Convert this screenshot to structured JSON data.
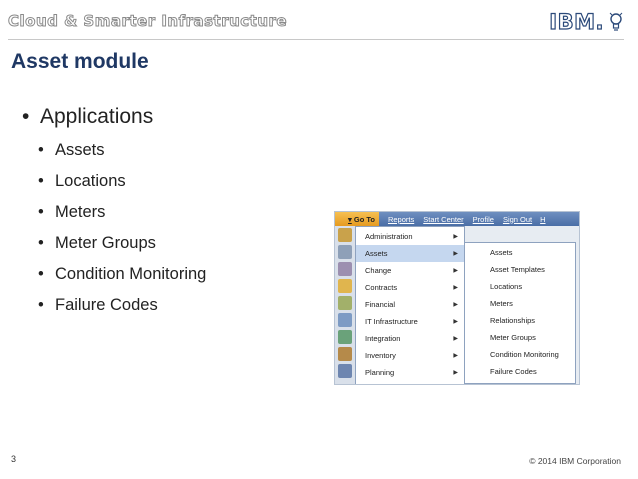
{
  "header": {
    "brand_text": "Cloud & Smarter Infrastructure",
    "ibm_logo": "IBM."
  },
  "slide": {
    "title": "Asset module",
    "main_bullet": "Applications",
    "sub_bullets": [
      "Assets",
      "Locations",
      "Meters",
      "Meter Groups",
      "Condition Monitoring",
      "Failure Codes"
    ]
  },
  "screenshot": {
    "topbar": {
      "goto": "Go To",
      "links": [
        "Reports",
        "Start Center",
        "Profile",
        "Sign Out"
      ],
      "truncated": "H"
    },
    "menu": [
      "Administration",
      "Assets",
      "Change",
      "Contracts",
      "Financial",
      "IT Infrastructure",
      "Integration",
      "Inventory",
      "Planning"
    ],
    "selected_menu": "Assets",
    "submenu": [
      "Assets",
      "Asset Templates",
      "Locations",
      "Meters",
      "Relationships",
      "Meter Groups",
      "Condition Monitoring",
      "Failure Codes"
    ]
  },
  "footer": {
    "page_number": "3",
    "copyright": "© 2014 IBM Corporation"
  }
}
